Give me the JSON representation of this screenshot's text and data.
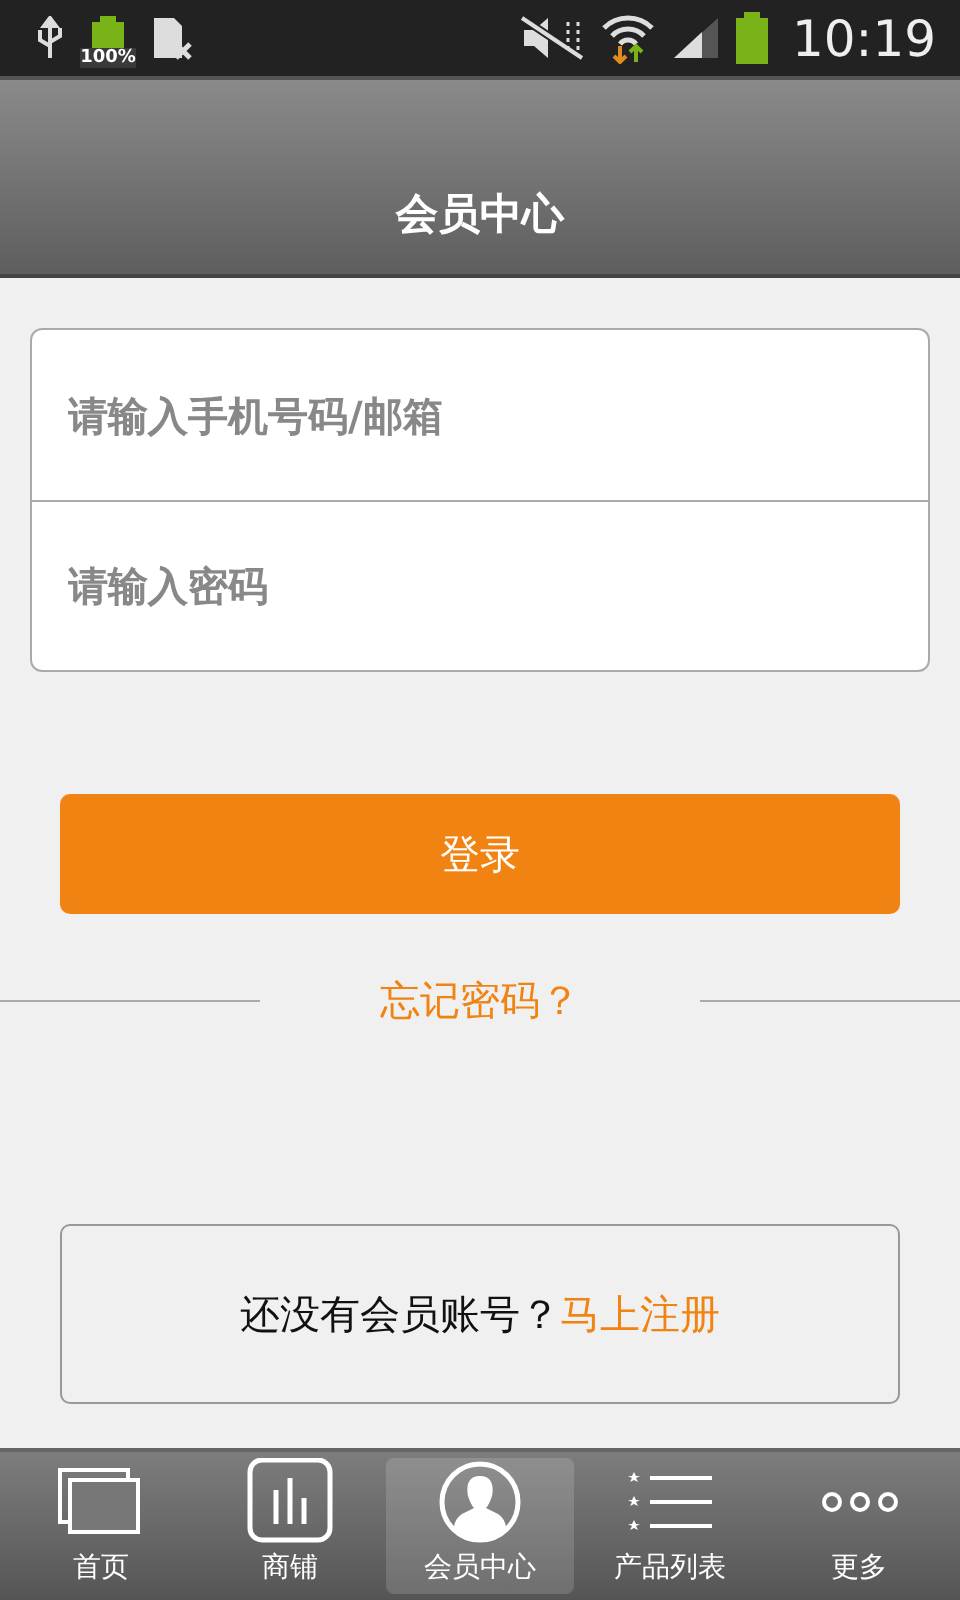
{
  "status_bar": {
    "battery_label": "100%",
    "time": "10:19"
  },
  "header": {
    "title": "会员中心"
  },
  "login_form": {
    "fields": [
      {
        "placeholder": "请输入手机号码/邮箱"
      },
      {
        "placeholder": "请输入密码"
      }
    ],
    "submit": "登录",
    "forgot": "忘记密码？"
  },
  "register": {
    "prompt": "还没有会员账号？",
    "link": "马上注册"
  },
  "tab_bar": [
    {
      "label": "首页",
      "kind": "home",
      "selected": false
    },
    {
      "label": "商铺",
      "kind": "shop",
      "selected": false
    },
    {
      "label": "会员中心",
      "kind": "member",
      "selected": true
    },
    {
      "label": "产品列表",
      "kind": "list",
      "selected": false
    },
    {
      "label": "更多",
      "kind": "more",
      "selected": false
    }
  ]
}
